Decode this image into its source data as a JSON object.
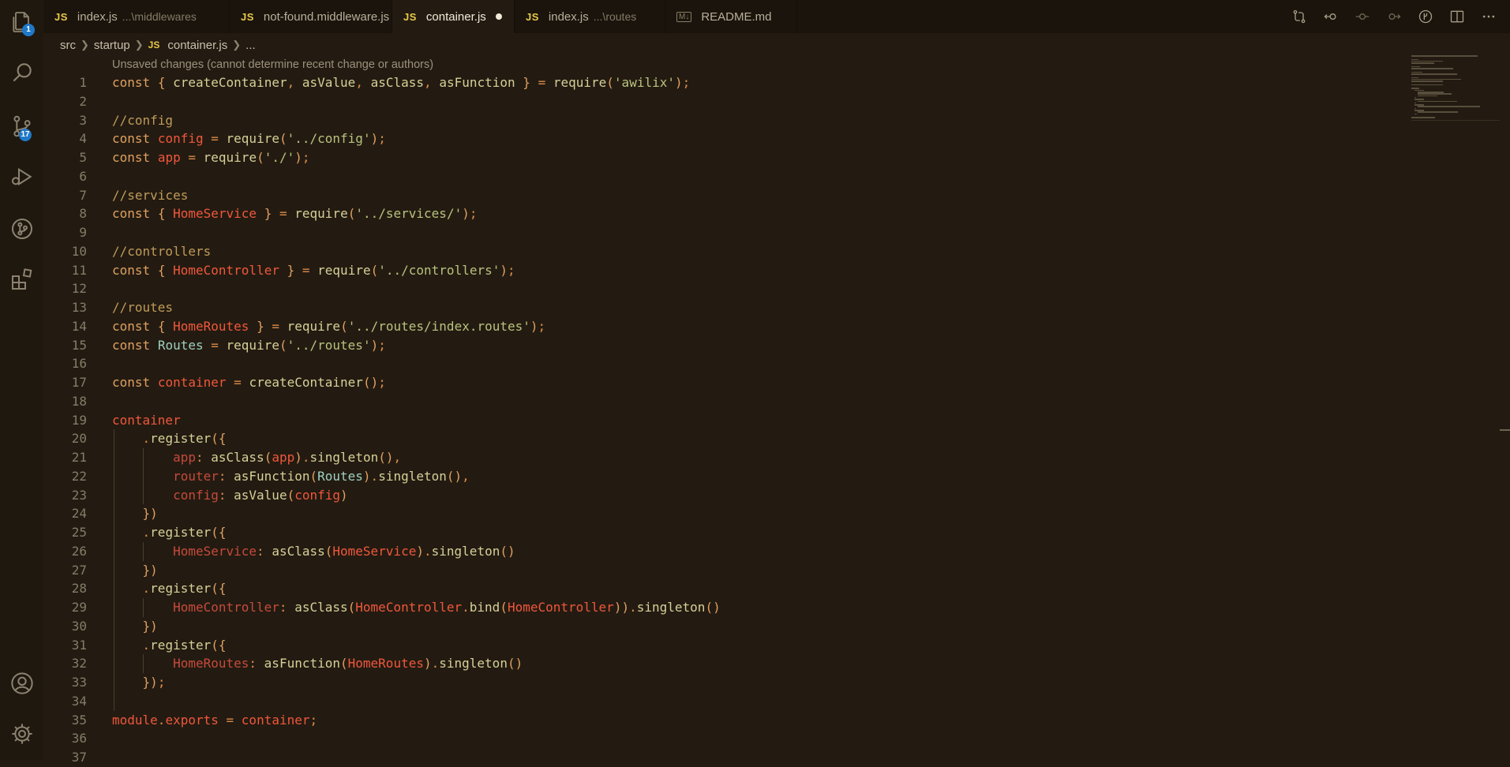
{
  "activity_bar": {
    "explorer_badge": "1",
    "source_control_badge": "17"
  },
  "tabs": [
    {
      "label": "index.js",
      "description": "...\\middlewares",
      "icon": "JS",
      "active": false
    },
    {
      "label": "not-found.middleware.js",
      "description": "",
      "icon": "JS",
      "active": false
    },
    {
      "label": "container.js",
      "description": "",
      "icon": "JS",
      "active": true,
      "dirty": true
    },
    {
      "label": "index.js",
      "description": "...\\routes",
      "icon": "JS",
      "active": false
    },
    {
      "label": "README.md",
      "description": "",
      "icon": "M↓",
      "active": false
    }
  ],
  "breadcrumb": {
    "parts": [
      "src",
      "startup",
      "container.js",
      "..."
    ],
    "file_icon": "JS"
  },
  "editor": {
    "hint": "Unsaved changes (cannot determine recent change or authors)",
    "lines": [
      "1",
      "2",
      "3",
      "4",
      "5",
      "6",
      "7",
      "8",
      "9",
      "10",
      "11",
      "12",
      "13",
      "14",
      "15",
      "16",
      "17",
      "18",
      "19",
      "20",
      "21",
      "22",
      "23",
      "24",
      "25",
      "26",
      "27",
      "28",
      "29",
      "30",
      "31",
      "32",
      "33",
      "34",
      "35",
      "36",
      "37"
    ],
    "code": {
      "l1": "const { createContainer, asValue, asClass, asFunction } = require('awilix');",
      "l3": "//config",
      "l4": "const config = require('../config');",
      "l5": "const app = require('./');",
      "l7": "//services",
      "l8": "const { HomeService } = require('../services/');",
      "l10": "//controllers",
      "l11": "const { HomeController } = require('../controllers');",
      "l13": "//routes",
      "l14": "const { HomeRoutes } = require('../routes/index.routes');",
      "l15": "const Routes = require('../routes');",
      "l17": "const container = createContainer();",
      "l19": "container",
      "l20": ".register({",
      "l21": "app: asClass(app).singleton(),",
      "l22": "router: asFunction(Routes).singleton(),",
      "l23": "config: asValue(config)",
      "l24": "})",
      "l25": ".register({",
      "l26": "HomeService: asClass(HomeService).singleton()",
      "l27": "})",
      "l28": ".register({",
      "l29": "HomeController: asClass(HomeController.bind(HomeController)).singleton()",
      "l30": "})",
      "l31": ".register({",
      "l32": "HomeRoutes: asFunction(HomeRoutes).singleton()",
      "l33": "});",
      "l35": "module.exports = container;"
    }
  },
  "colors": {
    "background": "#231b11",
    "keyword": "#e0a062",
    "variable": "#f0573c",
    "string": "#b8c27e",
    "comment": "#c09a5a",
    "function": "#d6d098",
    "badge": "#1f79c9"
  }
}
